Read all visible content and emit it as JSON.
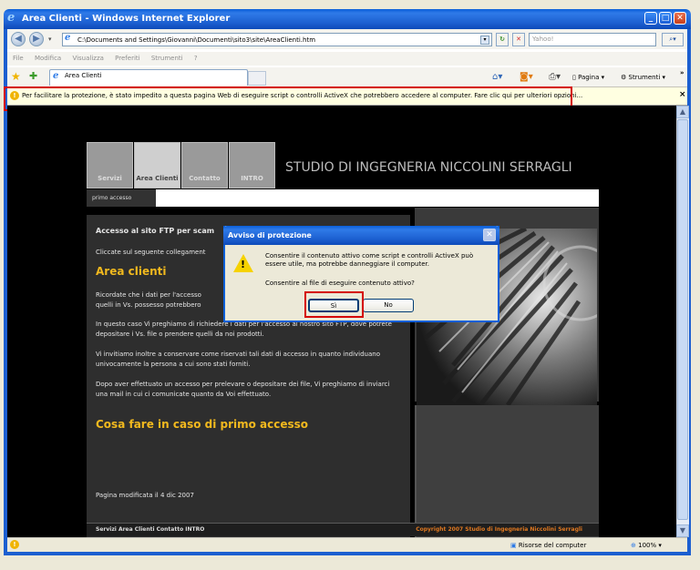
{
  "window": {
    "title": "Area Clienti - Windows Internet Explorer"
  },
  "toolbar": {
    "address": "C:\\Documents and Settings\\Giovanni\\Documenti\\sito3\\site\\AreaClienti.htm",
    "search_placeholder": "Yahoo!"
  },
  "menu": [
    "File",
    "Modifica",
    "Visualizza",
    "Preferiti",
    "Strumenti",
    "?"
  ],
  "tab": {
    "title": "Area Clienti"
  },
  "commandbar": {
    "page_label": "Pagina",
    "tools_label": "Strumenti"
  },
  "infobar": {
    "text": "Per facilitare la protezione, è stato impedito a questa pagina Web di eseguire script o controlli ActiveX che potrebbero accedere al computer. Fare clic qui per ulteriori opzioni...",
    "close": "×"
  },
  "site": {
    "nav": [
      "Servizi",
      "Area Clienti",
      "Contatto",
      "INTRO"
    ],
    "studio_title": "STUDIO DI INGEGNERIA NICCOLINI SERRAGLI",
    "subtab": "primo accesso",
    "ftp_heading": "Accesso al sito FTP per scam",
    "click_text": "Cliccate sul seguente collegament",
    "area_heading": "Area clienti",
    "p1": "Ricordate che i dati per l'accesso",
    "p1b": "quelli in Vs. possesso potrebbero",
    "p2": "In questo caso Vi preghiamo di richiedere i dati per l'accesso al nostro sito FTP, dove potrete depositare i Vs. file o prendere quelli da noi prodotti.",
    "p3": "Vi invitiamo inoltre a conservare come riservati tali dati di accesso in quanto individuano univocamente la persona a cui sono stati forniti.",
    "p4": "Dopo aver effettuato un accesso per prelevare o depositare dei file, Vi preghiamo di inviarci una mail in cui ci comunicate quanto da Voi effettuato.",
    "first_heading": "Cosa fare in caso di primo accesso",
    "modified": "Pagina modificata il 4 dic 2007",
    "footer_links": "Servizi  Area Clienti  Contatto  INTRO",
    "copyright": "Copyright 2007 Studio di Ingegneria Niccolini Serragli"
  },
  "dialog": {
    "title": "Avviso di protezione",
    "message": "Consentire il contenuto attivo come script e controlli ActiveX può essere utile, ma potrebbe danneggiare il computer.",
    "question": "Consentire al file di eseguire contenuto attivo?",
    "yes": "Sì",
    "no": "No"
  },
  "status": {
    "zone": "Risorse del computer",
    "zoom": "100%"
  }
}
